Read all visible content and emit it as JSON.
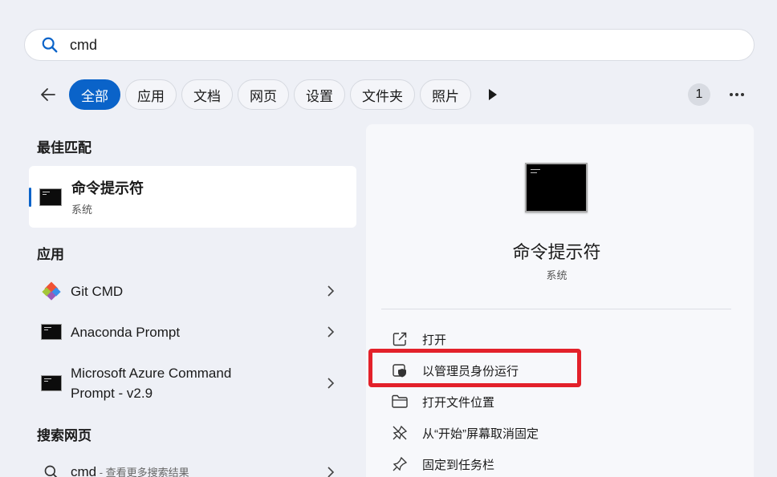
{
  "search": {
    "query": "cmd"
  },
  "filters": {
    "chips": [
      "全部",
      "应用",
      "文档",
      "网页",
      "设置",
      "文件夹",
      "照片"
    ],
    "count": "1"
  },
  "sections": {
    "best_match": "最佳匹配",
    "apps": "应用",
    "web": "搜索网页"
  },
  "best_match": {
    "title": "命令提示符",
    "subtitle": "系统"
  },
  "apps": [
    {
      "label": "Git CMD",
      "icon": "git-icon"
    },
    {
      "label": "Anaconda Prompt",
      "icon": "cmd-icon"
    },
    {
      "label": "Microsoft Azure Command Prompt - v2.9",
      "line1": "Microsoft Azure Command",
      "line2": "Prompt - v2.9",
      "icon": "cmd-icon"
    }
  ],
  "web": {
    "query": "cmd",
    "suffix": " - 查看更多搜索结果"
  },
  "detail": {
    "title": "命令提示符",
    "subtitle": "系统",
    "actions": [
      {
        "label": "打开",
        "icon": "open-external-icon"
      },
      {
        "label": "以管理员身份运行",
        "icon": "shield-icon"
      },
      {
        "label": "打开文件位置",
        "icon": "folder-icon"
      },
      {
        "label": "从“开始”屏幕取消固定",
        "icon": "unpin-icon"
      },
      {
        "label": "固定到任务栏",
        "icon": "pin-icon"
      }
    ]
  },
  "colors": {
    "accent": "#0a63c9",
    "highlight": "#e3212a"
  }
}
